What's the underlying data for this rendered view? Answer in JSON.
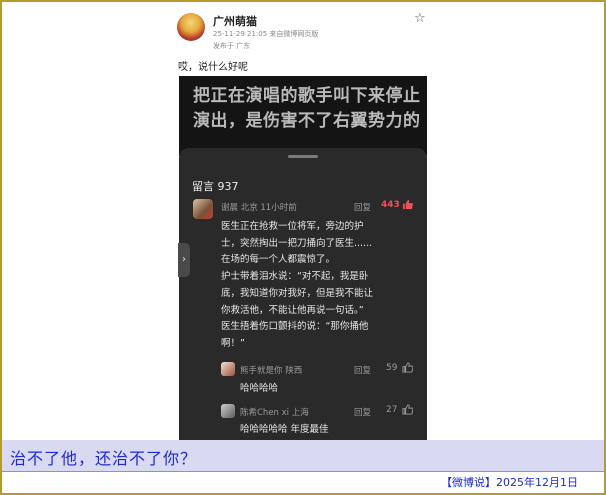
{
  "post": {
    "author": "广州萌猫",
    "meta": "25-11-29 21:05  来自微博网页版",
    "location": "发布于 广东",
    "star_glyph": "☆",
    "text": "哎，说什么好呢"
  },
  "video": {
    "caption": "把正在演唱的歌手叫下来停止演出，是伤害不了右翼势力的"
  },
  "comments": {
    "header": "留言 937",
    "side_tab_glyph": "›",
    "main": {
      "user": "谢晨  北京  11小时前",
      "reply_label": "回复",
      "likes": "443",
      "lines": [
        "医生正在抢救一位将军，旁边的护",
        "士，突然掏出一把刀捅向了医生......",
        "在场的每一个人都震惊了。",
        "护士带着泪水说：“对不起，我是卧",
        "底，我知道你对我好，但是我不能让",
        "你救活他，不能让他再说一句话。”",
        "医生捂着伤口颤抖的说：“那你捅他",
        "啊！”"
      ]
    },
    "replies": [
      {
        "user": "熊手就是你  陕西",
        "reply_label": "回复",
        "likes": "59",
        "text": "哈哈哈哈"
      },
      {
        "user": "陈希Chen xi  上海",
        "reply_label": "回复",
        "likes": "27",
        "text": "哈哈哈哈哈  年度最佳"
      }
    ]
  },
  "banner": {
    "title": "治不了他，还治不了你？",
    "footer": "【微博说】2025年12月1日"
  }
}
